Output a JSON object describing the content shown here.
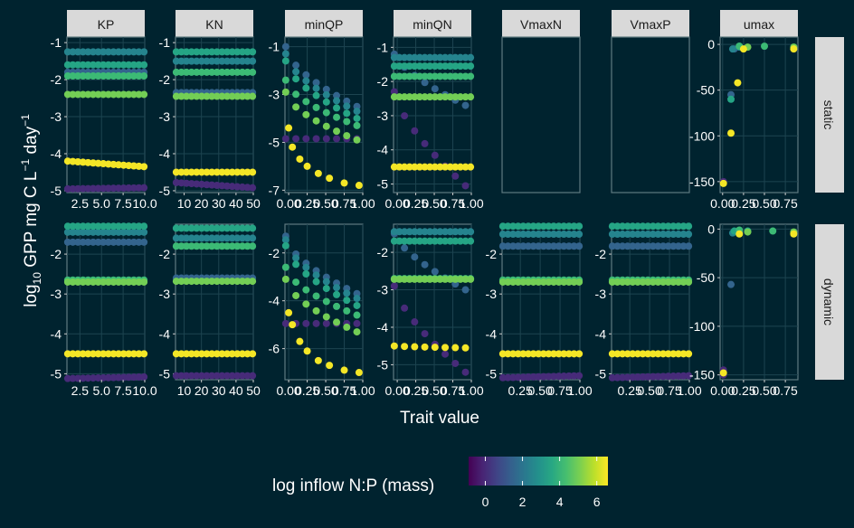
{
  "colors": {
    "background": "#00232f",
    "strip_fill": "#d9d9d9",
    "strip_text": "#1a1a1a",
    "panel_border": "#5f7a80",
    "grid": "#1d4450",
    "text": "#ffffff"
  },
  "chart_data": {
    "type": "scatter",
    "facet_columns": [
      "KP",
      "KN",
      "minQP",
      "minQN",
      "VmaxN",
      "VmaxP",
      "umax"
    ],
    "facet_rows": [
      "static",
      "dynamic"
    ],
    "xlabel": "Trait value",
    "ylabel_parts": {
      "log": "log",
      "sub": "10",
      "main": " GPP mg C L",
      "exp1": "−1",
      "day": " day",
      "exp2": "−1"
    },
    "legend": {
      "title": "log inflow N:P (mass)",
      "ticks": [
        "0",
        "2",
        "4",
        "6"
      ],
      "tick_values": [
        0,
        2,
        4,
        6
      ],
      "range": [
        -0.9,
        6.6
      ],
      "colormap": "viridis",
      "position": "bottom"
    },
    "panels": {
      "KP": {
        "x_ticks": [
          "2.5",
          "5.0",
          "7.5",
          "10.0"
        ],
        "x_tick_values": [
          2.5,
          5,
          7.5,
          10
        ],
        "xlim": [
          1,
          10
        ],
        "static": {
          "y_ticks": [
            "-1",
            "-2",
            "-3",
            "-4",
            "-5"
          ],
          "y_tick_values": [
            -1,
            -2,
            -3,
            -4,
            -5
          ],
          "ylim": [
            -5.05,
            -0.85
          ]
        },
        "dynamic": {
          "y_ticks": [
            "-2",
            "-3",
            "-4",
            "-5"
          ],
          "y_tick_values": [
            -2,
            -3,
            -4,
            -5
          ],
          "ylim": [
            -5.15,
            -1.25
          ]
        }
      },
      "KN": {
        "x_ticks": [
          "10",
          "20",
          "30",
          "40",
          "50"
        ],
        "x_tick_values": [
          10,
          20,
          30,
          40,
          50
        ],
        "xlim": [
          5,
          50
        ],
        "static": {
          "y_ticks": [
            "-1",
            "-2",
            "-3",
            "-4",
            "-5"
          ],
          "y_tick_values": [
            -1,
            -2,
            -3,
            -4,
            -5
          ],
          "ylim": [
            -5.05,
            -0.85
          ]
        },
        "dynamic": {
          "y_ticks": [
            "-2",
            "-3",
            "-4",
            "-5"
          ],
          "y_tick_values": [
            -2,
            -3,
            -4,
            -5
          ],
          "ylim": [
            -5.15,
            -1.25
          ]
        }
      },
      "minQP": {
        "x_ticks": [
          "0.00",
          "0.25",
          "0.50",
          "0.75",
          "1.00"
        ],
        "x_tick_values": [
          0,
          0.25,
          0.5,
          0.75,
          1
        ],
        "xlim": [
          -0.05,
          1.0
        ],
        "static": {
          "y_ticks": [
            "-1",
            "-3",
            "-5",
            "-7"
          ],
          "y_tick_values": [
            -1,
            -3,
            -5,
            -7
          ],
          "ylim": [
            -7.1,
            -0.6
          ]
        },
        "dynamic": {
          "y_ticks": [
            "-2",
            "-4",
            "-6"
          ],
          "y_tick_values": [
            -2,
            -4,
            -6
          ],
          "ylim": [
            -7.3,
            -0.8
          ]
        }
      },
      "minQN": {
        "x_ticks": [
          "0.00",
          "0.25",
          "0.50",
          "0.75",
          "1.00"
        ],
        "x_tick_values": [
          0,
          0.25,
          0.5,
          0.75,
          1
        ],
        "xlim": [
          -0.05,
          1.0
        ],
        "static": {
          "y_ticks": [
            "-1",
            "-2",
            "-3",
            "-4",
            "-5"
          ],
          "y_tick_values": [
            -1,
            -2,
            -3,
            -4,
            -5
          ],
          "ylim": [
            -5.25,
            -0.7
          ]
        },
        "dynamic": {
          "y_ticks": [
            "-2",
            "-3",
            "-4",
            "-5"
          ],
          "y_tick_values": [
            -2,
            -3,
            -4,
            -5
          ],
          "ylim": [
            -5.4,
            -1.25
          ]
        }
      },
      "VmaxN": {
        "x_ticks": [
          "0.25",
          "0.50",
          "0.75",
          "1.00"
        ],
        "x_tick_values": [
          0.25,
          0.5,
          0.75,
          1
        ],
        "xlim": [
          0.02,
          1.0
        ],
        "static": {
          "empty": true,
          "y_ticks": [],
          "y_tick_values": [],
          "ylim": [
            0,
            1
          ]
        },
        "dynamic": {
          "y_ticks": [
            "-2",
            "-3",
            "-4",
            "-5"
          ],
          "y_tick_values": [
            -2,
            -3,
            -4,
            -5
          ],
          "ylim": [
            -5.15,
            -1.25
          ]
        }
      },
      "VmaxP": {
        "x_ticks": [
          "0.25",
          "0.50",
          "0.75",
          "1.00"
        ],
        "x_tick_values": [
          0.25,
          0.5,
          0.75,
          1
        ],
        "xlim": [
          0.02,
          1.0
        ],
        "static": {
          "empty": true,
          "y_ticks": [],
          "y_tick_values": [],
          "ylim": [
            0,
            1
          ]
        },
        "dynamic": {
          "y_ticks": [
            "-2",
            "-3",
            "-4",
            "-5"
          ],
          "y_tick_values": [
            -2,
            -3,
            -4,
            -5
          ],
          "ylim": [
            -5.15,
            -1.25
          ]
        }
      },
      "umax": {
        "x_ticks": [
          "0.00",
          "0.25",
          "0.50",
          "0.75"
        ],
        "x_tick_values": [
          0,
          0.25,
          0.5,
          0.75
        ],
        "xlim": [
          -0.03,
          0.9
        ],
        "static": {
          "y_ticks": [
            "0",
            "-50",
            "-100",
            "-150"
          ],
          "y_tick_values": [
            0,
            -50,
            -100,
            -150
          ],
          "ylim": [
            -162,
            8
          ]
        },
        "dynamic": {
          "y_ticks": [
            "0",
            "-50",
            "-100",
            "-150"
          ],
          "y_tick_values": [
            0,
            -50,
            -100,
            -150
          ],
          "ylim": [
            -155,
            5
          ]
        }
      }
    },
    "series": [
      {
        "color_value": 0.0,
        "KP": {
          "static": [
            -4.95,
            -4.92
          ],
          "dynamic": [
            -5.12,
            -5.08
          ]
        },
        "KN": {
          "static": [
            -4.78,
            -4.92
          ],
          "dynamic": [
            -5.05,
            -5.05
          ]
        },
        "minQP": {
          "static": [
            -4.85,
            -4.85
          ],
          "dynamic": [
            -4.95,
            -4.95
          ]
        },
        "minQN": {
          "static_start": -2.3,
          "static_end": -5.05,
          "dynamic_start": -2.9,
          "dynamic_end": -5.2
        },
        "VmaxN": {
          "dynamic": [
            -5.1,
            -5.05
          ]
        },
        "VmaxP": {
          "dynamic": [
            -5.1,
            -5.05
          ]
        },
        "umax": {
          "static": [
            [
              0.01,
              -150
            ]
          ],
          "dynamic": [
            [
              0.01,
              -145
            ],
            [
              0.01,
              -150
            ]
          ]
        }
      },
      {
        "color_value": 1.5,
        "KP": {
          "static": [
            -1.8,
            -1.8
          ],
          "dynamic": [
            -1.7,
            -1.7
          ]
        },
        "KN": {
          "static": [
            -2.35,
            -2.35
          ],
          "dynamic": [
            -2.6,
            -2.6
          ]
        },
        "minQP": {
          "static": [
            -1.0,
            -3.5
          ],
          "dynamic": [
            -1.3,
            -3.7
          ]
        },
        "minQN": {
          "static_start": -1.2,
          "static_end": -2.7,
          "dynamic_start": -1.5,
          "dynamic_end": -3.0
        },
        "VmaxN": {
          "dynamic": [
            -1.8,
            -1.8
          ]
        },
        "VmaxP": {
          "dynamic": [
            -1.8,
            -1.8
          ]
        },
        "umax": {
          "static": [
            [
              0.1,
              -55
            ],
            [
              0.14,
              -5
            ]
          ],
          "dynamic": [
            [
              0.1,
              -57
            ],
            [
              0.14,
              -3
            ]
          ]
        }
      },
      {
        "color_value": 2.5,
        "KP": {
          "static": [
            -1.25,
            -1.25
          ],
          "dynamic": [
            -1.45,
            -1.45
          ]
        },
        "KN": {
          "static": [
            -1.5,
            -1.5
          ],
          "dynamic": [
            -1.6,
            -1.6
          ]
        },
        "minQP": {
          "static": [
            -1.3,
            -3.7
          ],
          "dynamic": [
            -1.45,
            -3.9
          ]
        },
        "minQN": {
          "static_start": -1.3,
          "static_end": -1.3,
          "dynamic_start": -1.45,
          "dynamic_end": -1.45
        },
        "VmaxN": {
          "dynamic": [
            -1.5,
            -1.5
          ]
        },
        "VmaxP": {
          "dynamic": [
            -1.5,
            -1.5
          ]
        },
        "umax": {
          "static": [
            [
              0.12,
              -5
            ],
            [
              0.2,
              -3
            ]
          ],
          "dynamic": [
            [
              0.12,
              -4
            ],
            [
              0.2,
              -3
            ]
          ]
        }
      },
      {
        "color_value": 3.5,
        "KP": {
          "static": [
            -1.6,
            -1.6
          ],
          "dynamic": [
            -1.3,
            -1.3
          ]
        },
        "KN": {
          "static": [
            -1.25,
            -1.25
          ],
          "dynamic": [
            -1.35,
            -1.35
          ]
        },
        "minQP": {
          "static": [
            -1.6,
            -4.0
          ],
          "dynamic": [
            -1.7,
            -4.2
          ]
        },
        "minQN": {
          "static_start": -1.55,
          "static_end": -1.55,
          "dynamic_start": -1.7,
          "dynamic_end": -1.7
        },
        "VmaxN": {
          "dynamic": [
            -1.3,
            -1.3
          ]
        },
        "VmaxP": {
          "dynamic": [
            -1.3,
            -1.3
          ]
        },
        "umax": {
          "static": [
            [
              0.1,
              -60
            ],
            [
              0.2,
              -2
            ]
          ],
          "dynamic": [
            [
              0.14,
              -2
            ],
            [
              0.3,
              -2
            ]
          ]
        }
      },
      {
        "color_value": 4.2,
        "KP": {
          "static": [
            -1.9,
            -1.9
          ],
          "dynamic": [
            -2.65,
            -2.65
          ]
        },
        "KN": {
          "static": [
            -1.8,
            -1.8
          ],
          "dynamic": [
            -1.8,
            -1.8
          ]
        },
        "minQP": {
          "static": [
            -2.4,
            -4.3
          ],
          "dynamic": [
            -2.6,
            -4.6
          ]
        },
        "minQN": {
          "static_start": -1.85,
          "static_end": -1.85,
          "dynamic_start": -2.7,
          "dynamic_end": -2.7
        },
        "VmaxN": {
          "dynamic": [
            -2.65,
            -2.65
          ]
        },
        "VmaxP": {
          "dynamic": [
            -2.65,
            -2.65
          ]
        },
        "umax": {
          "static": [
            [
              0.2,
              -2
            ],
            [
              0.5,
              -2
            ]
          ],
          "dynamic": [
            [
              0.2,
              -1
            ],
            [
              0.6,
              -2
            ]
          ]
        }
      },
      {
        "color_value": 5.0,
        "KP": {
          "static": [
            -2.4,
            -2.4
          ],
          "dynamic": [
            -2.7,
            -2.7
          ]
        },
        "KN": {
          "static": [
            -2.45,
            -2.45
          ],
          "dynamic": [
            -2.68,
            -2.68
          ]
        },
        "minQP": {
          "static": [
            -2.9,
            -4.9
          ],
          "dynamic": [
            -3.1,
            -5.3
          ]
        },
        "minQN": {
          "static_start": -2.45,
          "static_end": -2.45,
          "dynamic_start": -2.72,
          "dynamic_end": -2.72
        },
        "VmaxN": {
          "dynamic": [
            -2.7,
            -2.7
          ]
        },
        "VmaxP": {
          "dynamic": [
            -2.7,
            -2.7
          ]
        },
        "umax": {
          "static": [
            [
              0.3,
              -3
            ],
            [
              0.85,
              -3
            ]
          ],
          "dynamic": [
            [
              0.3,
              -3
            ],
            [
              0.85,
              -3
            ]
          ]
        }
      },
      {
        "color_value": 6.5,
        "KP": {
          "static": [
            -4.2,
            -4.35
          ],
          "dynamic": [
            -4.5,
            -4.5
          ]
        },
        "KN": {
          "static": [
            -4.5,
            -4.5
          ],
          "dynamic": [
            -4.5,
            -4.5
          ]
        },
        "minQP": {
          "static_curve": [
            [
              0.0,
              -4.4
            ],
            [
              0.05,
              -5.2
            ],
            [
              0.15,
              -5.7
            ],
            [
              0.25,
              -6.0
            ],
            [
              0.4,
              -6.3
            ],
            [
              0.55,
              -6.5
            ],
            [
              0.75,
              -6.7
            ],
            [
              0.95,
              -6.8
            ]
          ],
          "dynamic_curve": [
            [
              0.0,
              -4.5
            ],
            [
              0.05,
              -5.0
            ],
            [
              0.15,
              -5.7
            ],
            [
              0.25,
              -6.1
            ],
            [
              0.4,
              -6.5
            ],
            [
              0.55,
              -6.7
            ],
            [
              0.75,
              -6.9
            ],
            [
              0.95,
              -7.0
            ]
          ]
        },
        "minQN": {
          "static_start": -4.5,
          "static_end": -4.5,
          "dynamic_start": -4.5,
          "dynamic_end": -4.55
        },
        "VmaxN": {
          "dynamic": [
            -4.5,
            -4.5
          ]
        },
        "VmaxP": {
          "dynamic": [
            -4.5,
            -4.5
          ]
        },
        "umax": {
          "static": [
            [
              0.01,
              -152
            ],
            [
              0.1,
              -97
            ],
            [
              0.18,
              -42
            ],
            [
              0.25,
              -5
            ],
            [
              0.85,
              -5
            ]
          ],
          "dynamic": [
            [
              0.01,
              -148
            ],
            [
              0.2,
              -5
            ],
            [
              0.85,
              -5
            ]
          ]
        }
      }
    ]
  }
}
